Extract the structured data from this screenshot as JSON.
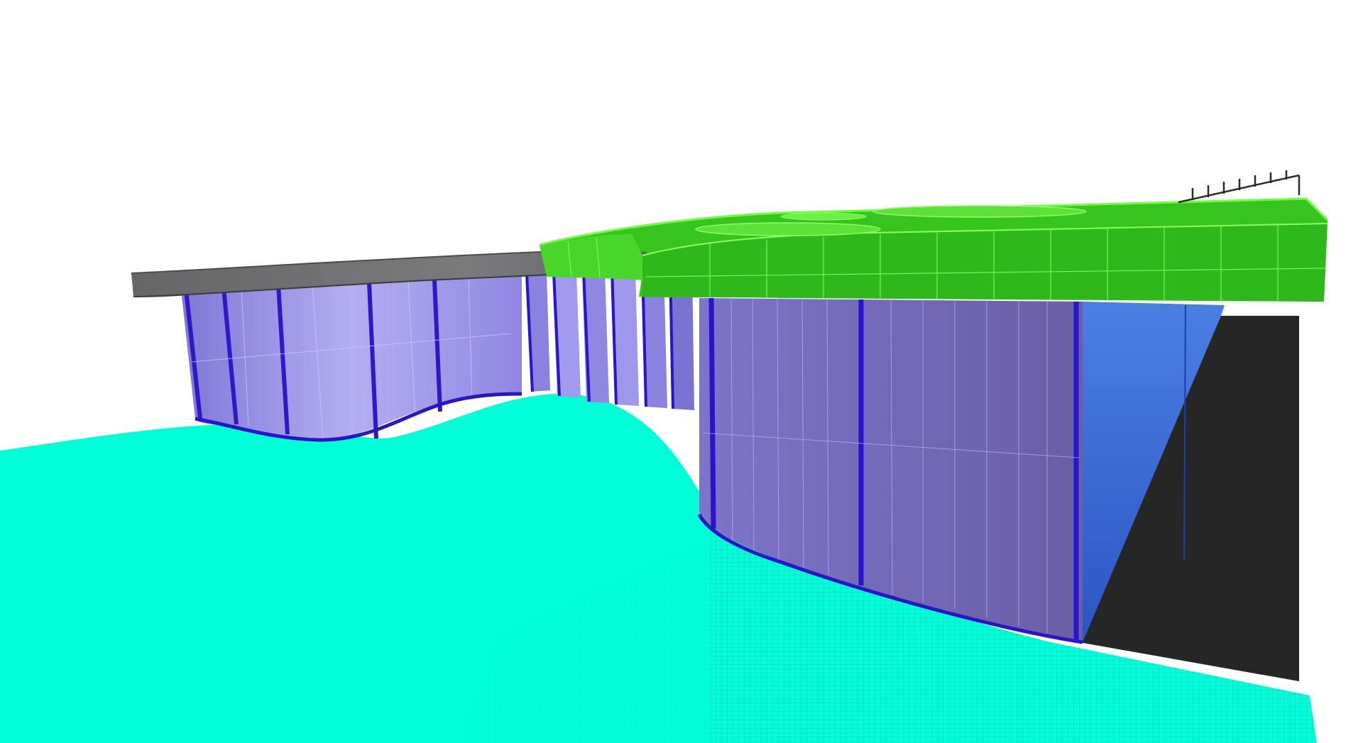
{
  "scene": {
    "kind": "3d-architectural-model-render",
    "background_color": "#ffffff",
    "colors": {
      "ground_plane": "#00ffd9",
      "ground_mesh_lines": "#2a9e9a",
      "facade_glass": "#9c95e8",
      "facade_glass_shadow": "#6a5fa8",
      "facade_mullion": "#3018c8",
      "roof_canopy_grey": "#6e6e70",
      "roof_canopy_green": "#37c41f",
      "roof_green_edge": "#6cff3c",
      "side_wall_blue": "#3a6fd8",
      "dark_side_face": "#262626",
      "railing": "#2b2b2b"
    }
  }
}
